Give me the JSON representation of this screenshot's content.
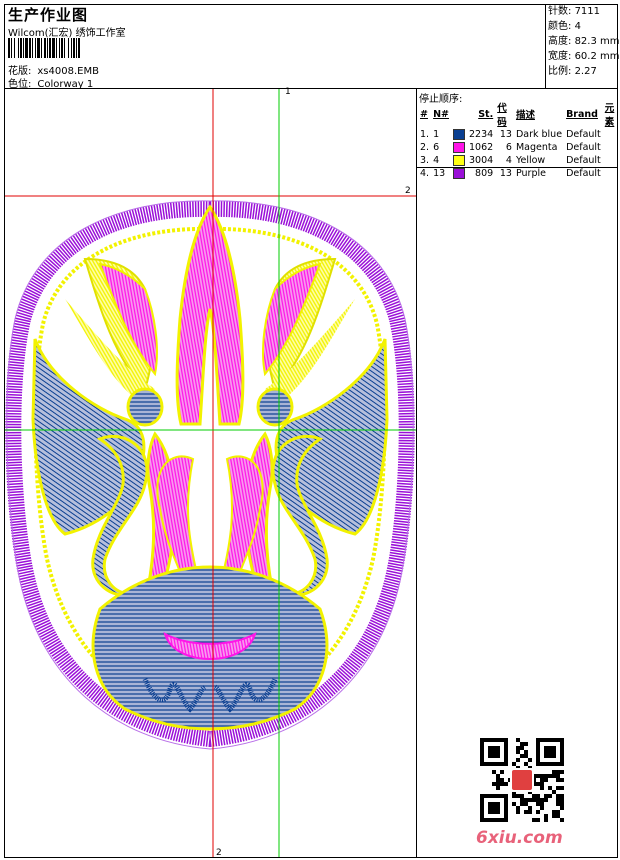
{
  "header": {
    "title": "生产作业图",
    "company": "Wilcom(汇宏) 绣饰工作室",
    "design_label": "花版:",
    "design_value": "xs4008.EMB",
    "colorway_label": "色位:",
    "colorway_value": "Colorway 1"
  },
  "stats": [
    {
      "label": "针数:",
      "value": "7111"
    },
    {
      "label": "颜色:",
      "value": "4"
    },
    {
      "label": "高度:",
      "value": "82.3 mm"
    },
    {
      "label": "宽度:",
      "value": "60.2 mm"
    },
    {
      "label": "比例:",
      "value": "2.27"
    }
  ],
  "legend": {
    "title": "停止顺序:",
    "columns": [
      "#",
      "N#",
      "St.",
      "代码",
      "描述",
      "Brand",
      "元素"
    ],
    "rows": [
      {
        "idx": "1.",
        "n": "1",
        "color": "#0a3f91",
        "st": "2234",
        "code": "13",
        "desc": "Dark blue",
        "brand": "Default"
      },
      {
        "idx": "2.",
        "n": "6",
        "color": "#ff14e8",
        "st": "1062",
        "code": "6",
        "desc": "Magenta",
        "brand": "Default"
      },
      {
        "idx": "3.",
        "n": "4",
        "color": "#ffff14",
        "st": "3004",
        "code": "4",
        "desc": "Yellow",
        "brand": "Default"
      },
      {
        "idx": "4.",
        "n": "13",
        "color": "#9a10d8",
        "st": "809",
        "code": "13",
        "desc": "Purple",
        "brand": "Default"
      }
    ]
  },
  "guides": {
    "green_top": "1",
    "red_right": "2",
    "red_bottom": "2"
  },
  "watermark": "6xiu.com",
  "colors": {
    "blue": "#0a3f91",
    "magenta": "#ff14e8",
    "yellow": "#ffff14",
    "purple": "#9a10d8",
    "red_guide": "#e00000",
    "green_guide": "#00cc00"
  }
}
